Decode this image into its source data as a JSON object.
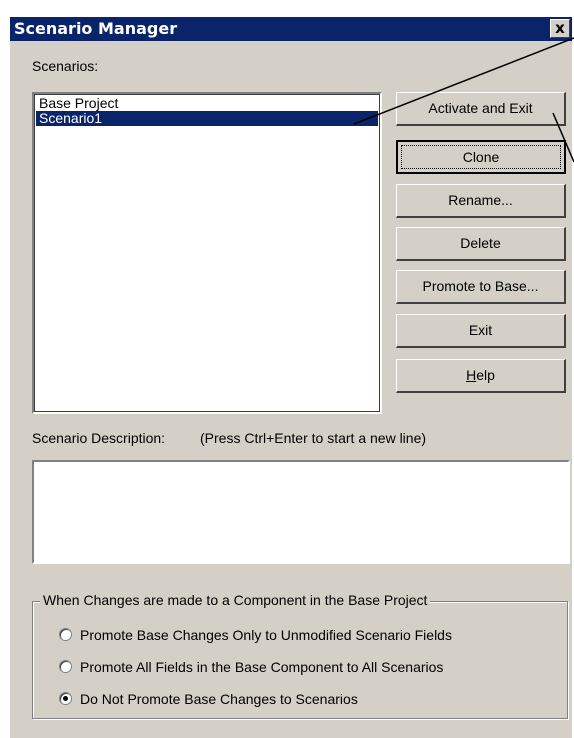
{
  "window": {
    "title": "Scenario Manager",
    "close_glyph": "x"
  },
  "scenarios": {
    "label": "Scenarios:",
    "items": [
      "Base Project",
      "Scenario1"
    ],
    "selected": "Scenario1"
  },
  "buttons": {
    "activate_exit": "Activate and Exit",
    "clone": "Clone",
    "rename": "Rename...",
    "delete": "Delete",
    "promote_to_base": "Promote to Base...",
    "exit": "Exit",
    "help_mnemonic": "H",
    "help_rest": "elp"
  },
  "description": {
    "label": "Scenario Description:",
    "hint": "(Press Ctrl+Enter to start a new line)",
    "value": ""
  },
  "promote_group": {
    "legend": "When Changes are made to a Component in the Base Project",
    "options": [
      "Promote Base Changes Only to Unmodified Scenario Fields",
      "Promote All Fields in the Base Component to All Scenarios",
      "Do Not Promote Base Changes to Scenarios"
    ],
    "selected": "Do Not Promote Base Changes to Scenarios"
  },
  "colors": {
    "titlebar": "#0a246a",
    "face": "#d4d0c8",
    "selection": "#0a246a"
  }
}
